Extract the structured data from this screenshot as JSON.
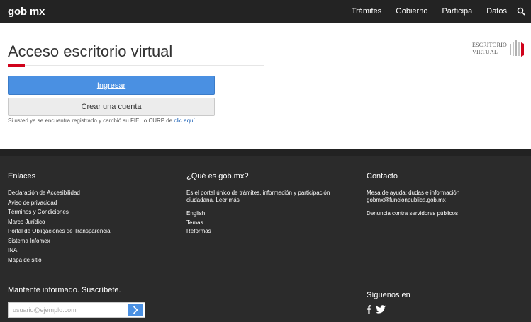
{
  "header": {
    "logo": "gob mx",
    "nav": [
      "Trámites",
      "Gobierno",
      "Participa",
      "Datos"
    ]
  },
  "main": {
    "title": "Acceso escritorio virtual",
    "brand_line1": "ESCRITORIO",
    "brand_line2": "VIRTUAL",
    "login_button": "Ingresar",
    "create_button": "Crear una cuenta",
    "hint_text": "Si usted ya se encuentra registrado y cambió su FIEL o CURP de ",
    "hint_link": "clic aquí"
  },
  "footer": {
    "links": {
      "heading": "Enlaces",
      "items": [
        "Declaración de Accesibilidad",
        "Aviso de privacidad",
        "Términos y Condiciones",
        "Marco Jurídico",
        "Portal de Obligaciones de Transparencia",
        "Sistema Infomex",
        "INAI",
        "Mapa de sitio"
      ]
    },
    "about": {
      "heading": "¿Qué es gob.mx?",
      "text1": "Es el portal único de trámites, información y participación",
      "text2": "ciudadana. Leer más",
      "items": [
        "English",
        "Temas",
        "Reformas"
      ]
    },
    "contact": {
      "heading": "Contacto",
      "line1": "Mesa de ayuda: dudas e información",
      "line2": "gobmx@funcionpublica.gob.mx",
      "line3": "Denuncia contra servidores públicos"
    },
    "subscribe_heading": "Mantente informado. Suscríbete.",
    "email_placeholder": "usuario@ejemplo.com",
    "follow_heading": "Síguenos en"
  },
  "colors": {
    "header_bg": "#232323",
    "footer_bg": "#2b2b2b",
    "primary": "#4a90e2",
    "accent": "#d0021b"
  }
}
